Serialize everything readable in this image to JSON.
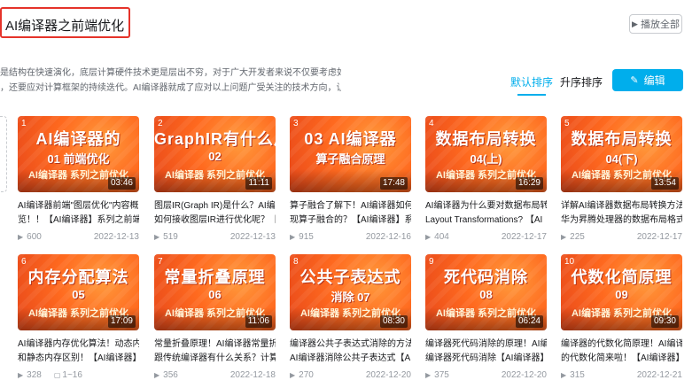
{
  "header": {
    "title": "AI编译器之前端优化",
    "play_all_label": "播放全部"
  },
  "description": {
    "line1": "是结构在快速演化，底层计算硬件技术更是层出不穷，对于广大开发者来说不仅要考虑如何在复杂多",
    "line2": "，还要应对计算框架的持续迭代。AI编译器就成了应对以上问题广受关注的技术方向，让用户仅..."
  },
  "toolbar": {
    "sort_default": "默认排序",
    "sort_asc": "升序排序",
    "edit_label": "编辑"
  },
  "icons": {
    "play_all": "play-list-icon",
    "edit": "edit-icon",
    "play_count": "play-count-icon"
  },
  "colors": {
    "accent": "#00aeec",
    "highlight_border": "#e5332a",
    "thumb_orange": "#ff6a1f"
  },
  "videos": [
    {
      "num": "1",
      "cover1": "AI编译器的",
      "cover2": "01  前端优化",
      "cover3": "AI编译器  系列之前优化",
      "duration": "03:46",
      "title1": "AI编译器前端\"图层优化\"内容概",
      "title2": "览！！【AI编译器】系列之前端优",
      "plays": "600",
      "date": "2022-12-13"
    },
    {
      "num": "2",
      "cover1": "GraphIR有什么用",
      "cover2": "02",
      "cover3": "AI编译器  系列之前优化",
      "duration": "11:11",
      "title1": "图层IR(Graph IR)是什么？AI编译器",
      "title2": "如何接收图层IR进行优化呢？【AI",
      "plays": "519",
      "date": "2022-12-13"
    },
    {
      "num": "3",
      "cover1": "03 AI编译器",
      "cover2": "算子融合原理",
      "cover3": "",
      "duration": "17:48",
      "title1": "算子融合了解下！AI编译器如何实",
      "title2": "现算子融合的？【AI编译器】系列",
      "plays": "915",
      "date": "2022-12-16"
    },
    {
      "num": "4",
      "cover1": "数据布局转换",
      "cover2": "04(上)",
      "cover3": "AI编译器  系列之前优化",
      "duration": "16:29",
      "title1": "AI编译器为什么要对数据布局转换呢",
      "title2": "Layout Transformations? 【AI",
      "plays": "404",
      "date": "2022-12-17"
    },
    {
      "num": "5",
      "cover1": "数据布局转换",
      "cover2": "04(下)",
      "cover3": "AI编译器  系列之前优化",
      "duration": "13:54",
      "title1": "详解AI编译器数据布局转换方法！",
      "title2": "华为昇腾处理器的数据布局格式！",
      "plays": "225",
      "date": "2022-12-17"
    },
    {
      "num": "6",
      "cover1": "内存分配算法",
      "cover2": "05",
      "cover3": "AI编译器  系列之前优化",
      "duration": "17:09",
      "title1": "AI编译器内存优化算法！动态内存",
      "title2": "和静态内存区别！【AI编译器】前",
      "plays": "328",
      "pages": "1~16"
    },
    {
      "num": "7",
      "cover1": "常量折叠原理",
      "cover2": "06",
      "cover3": "AI编译器  系列之前优化",
      "duration": "11:06",
      "title1": "常量折叠原理！AI编译器常量折叠",
      "title2": "跟传统编译器有什么关系？计算图也",
      "plays": "356",
      "date": "2022-12-18"
    },
    {
      "num": "8",
      "cover1": "公共子表达式",
      "cover2": "消除 07",
      "cover3": "AI编译器  系列之前优化",
      "duration": "08:30",
      "title1": "编译器公共子表达式消除的方法！",
      "title2": "AI编译器消除公共子表达式【AI编译",
      "plays": "270",
      "date": "2022-12-20"
    },
    {
      "num": "9",
      "cover1": "死代码消除",
      "cover2": "08",
      "cover3": "AI编译器  系列之前优化",
      "duration": "06:24",
      "title1": "编译器死代码消除的原理！AI编译器",
      "title2": "编译器死代码消除【AI编译器】系列",
      "plays": "375",
      "date": "2022-12-20"
    },
    {
      "num": "10",
      "cover1": "代数化简原理",
      "cover2": "09",
      "cover3": "AI编译器  系列之前优化",
      "duration": "09:30",
      "title1": "编译器的代数化简原理！AI编译器",
      "title2": "的代数化简来啦！【AI编译器】系",
      "plays": "315",
      "date": "2022-12-21"
    }
  ]
}
